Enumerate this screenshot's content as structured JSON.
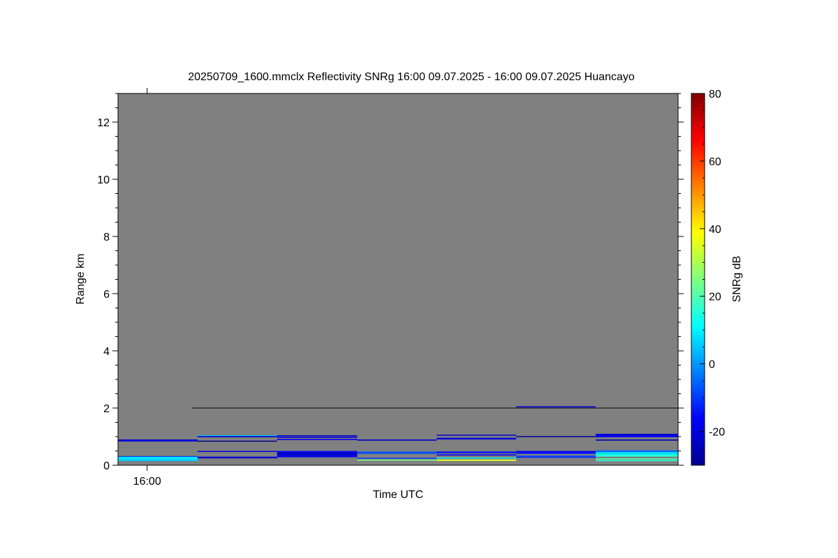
{
  "chart_data": {
    "type": "heatmap",
    "title": "20250709_1600.mmclx Reflectivity SNRg   16:00 09.07.2025 - 16:00 09.07.2025 Huancayo",
    "xlabel": "Time UTC",
    "ylabel": "Range km",
    "ylim": [
      0,
      13
    ],
    "y_ticks": [
      "0",
      "2",
      "4",
      "6",
      "8",
      "10",
      "12"
    ],
    "y_tick_values": [
      0,
      2,
      4,
      6,
      8,
      10,
      12
    ],
    "x_tick_labels": [
      "16:00"
    ],
    "x_tick_positions": [
      0.052
    ],
    "background_color": "#808080",
    "colorbar": {
      "label": "SNRg dB",
      "range": [
        -30,
        80
      ],
      "ticks": [
        "-20",
        "0",
        "20",
        "40",
        "60",
        "80"
      ],
      "tick_values": [
        -20,
        0,
        20,
        40,
        60,
        80
      ],
      "colormap": "jet"
    },
    "segments": [
      {
        "x0": 0.0,
        "x1": 0.142,
        "bands": [
          [
            0.88,
            0.9,
            -22
          ],
          [
            0.83,
            0.88,
            -20
          ],
          [
            0.3,
            0.32,
            -18
          ],
          [
            0.18,
            0.3,
            8
          ],
          [
            0.16,
            0.18,
            5
          ]
        ]
      },
      {
        "x0": 0.142,
        "x1": 0.284,
        "bands": [
          [
            1.02,
            1.05,
            5
          ],
          [
            0.98,
            1.02,
            -22
          ],
          [
            0.84,
            0.86,
            -30
          ],
          [
            0.48,
            0.5,
            -20
          ],
          [
            0.28,
            0.3,
            -18
          ],
          [
            0.24,
            0.28,
            -22
          ]
        ]
      },
      {
        "x0": 0.284,
        "x1": 0.427,
        "bands": [
          [
            1.02,
            1.05,
            -22
          ],
          [
            0.96,
            1.0,
            -20
          ],
          [
            0.88,
            0.92,
            -18
          ],
          [
            0.46,
            0.5,
            -15
          ],
          [
            0.36,
            0.46,
            -22
          ],
          [
            0.28,
            0.36,
            -18
          ]
        ]
      },
      {
        "x0": 0.427,
        "x1": 0.569,
        "bands": [
          [
            0.86,
            0.9,
            -22
          ],
          [
            0.46,
            0.48,
            -5
          ],
          [
            0.4,
            0.46,
            -8
          ],
          [
            0.24,
            0.26,
            -10
          ],
          [
            0.16,
            0.2,
            25
          ]
        ]
      },
      {
        "x0": 0.569,
        "x1": 0.711,
        "bands": [
          [
            1.04,
            1.07,
            -22
          ],
          [
            0.9,
            0.96,
            -20
          ],
          [
            0.42,
            0.48,
            -15
          ],
          [
            0.34,
            0.38,
            -18
          ],
          [
            0.24,
            0.27,
            10
          ],
          [
            0.15,
            0.2,
            35
          ]
        ]
      },
      {
        "x0": 0.711,
        "x1": 0.853,
        "bands": [
          [
            2.04,
            2.06,
            -20
          ],
          [
            1.0,
            1.02,
            -28
          ],
          [
            0.46,
            0.5,
            -18
          ],
          [
            0.4,
            0.46,
            -15
          ],
          [
            0.3,
            0.34,
            -8
          ],
          [
            0.26,
            0.3,
            -12
          ]
        ]
      },
      {
        "x0": 0.853,
        "x1": 1.0,
        "bands": [
          [
            1.06,
            1.1,
            -22
          ],
          [
            0.98,
            1.06,
            -18
          ],
          [
            0.86,
            0.9,
            -25
          ],
          [
            0.46,
            0.52,
            -5
          ],
          [
            0.38,
            0.46,
            8
          ],
          [
            0.3,
            0.38,
            15
          ],
          [
            0.2,
            0.24,
            20
          ],
          [
            0.14,
            0.18,
            15
          ]
        ]
      }
    ],
    "reference_lines": [
      {
        "y": 2.0,
        "x0": 0.132,
        "x1": 1.0,
        "color": "#000000"
      }
    ]
  }
}
